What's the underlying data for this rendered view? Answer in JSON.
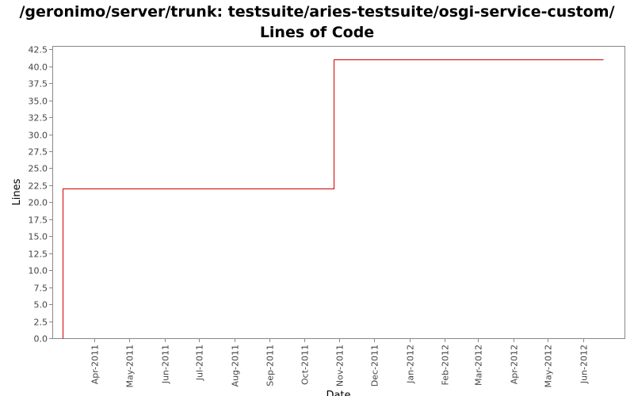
{
  "title": "/geronimo/server/trunk: testsuite/aries-testsuite/osgi-service-custom/",
  "subtitle": "Lines of Code",
  "chart_data": {
    "type": "line",
    "title": "/geronimo/server/trunk: testsuite/aries-testsuite/osgi-service-custom/",
    "subtitle": "Lines of Code",
    "xlabel": "Date",
    "ylabel": "Lines",
    "x_type": "date",
    "xlim": [
      "2011-02-23",
      "2012-07-07"
    ],
    "ylim": [
      0,
      43
    ],
    "yticks": [
      0.0,
      2.5,
      5.0,
      7.5,
      10.0,
      12.5,
      15.0,
      17.5,
      20.0,
      22.5,
      25.0,
      27.5,
      30.0,
      32.5,
      35.0,
      37.5,
      40.0,
      42.5
    ],
    "ytick_labels": [
      "0.0",
      "2.5",
      "5.0",
      "7.5",
      "10.0",
      "12.5",
      "15.0",
      "17.5",
      "20.0",
      "22.5",
      "25.0",
      "27.5",
      "30.0",
      "32.5",
      "35.0",
      "37.5",
      "40.0",
      "42.5"
    ],
    "xticks": [
      "2011-04-01",
      "2011-05-01",
      "2011-06-01",
      "2011-07-01",
      "2011-08-01",
      "2011-09-01",
      "2011-10-01",
      "2011-11-01",
      "2011-12-01",
      "2012-01-01",
      "2012-02-01",
      "2012-03-01",
      "2012-04-01",
      "2012-05-01",
      "2012-06-01"
    ],
    "xtick_labels": [
      "Apr-2011",
      "May-2011",
      "Jun-2011",
      "Jul-2011",
      "Aug-2011",
      "Sep-2011",
      "Oct-2011",
      "Nov-2011",
      "Dec-2011",
      "Jan-2012",
      "Feb-2012",
      "Mar-2012",
      "Apr-2012",
      "May-2012",
      "Jun-2012"
    ],
    "grid": false,
    "legend": "none",
    "series": [
      {
        "color": "#cc0000",
        "step": true,
        "points": [
          {
            "x": "2011-03-04",
            "y": 0
          },
          {
            "x": "2011-03-04",
            "y": 22
          },
          {
            "x": "2011-10-27",
            "y": 22
          },
          {
            "x": "2011-10-27",
            "y": 41
          },
          {
            "x": "2012-06-18",
            "y": 41
          }
        ]
      }
    ]
  }
}
